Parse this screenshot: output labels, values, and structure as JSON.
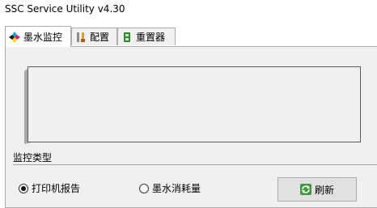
{
  "window": {
    "title": "SSC Service Utility v4.30"
  },
  "tabs": [
    {
      "label": "墨水监控",
      "icon": "ink-drops-icon",
      "active": true
    },
    {
      "label": "配置",
      "icon": "settings-tools-icon",
      "active": false
    },
    {
      "label": "重置器",
      "icon": "reset-chip-icon",
      "active": false
    }
  ],
  "monitor": {
    "group_label": "监控类型",
    "options": [
      {
        "label": "打印机报告",
        "checked": true
      },
      {
        "label": "墨水消耗量",
        "checked": false
      }
    ],
    "refresh_label": "刷新",
    "refresh_icon": "refresh-icon"
  },
  "colors": {
    "ink_cyan": "#00a8e0",
    "ink_magenta": "#e2157a",
    "ink_yellow": "#f5d800",
    "ink_black": "#1a1a1a",
    "panel_bg": "#f0f0f0"
  }
}
